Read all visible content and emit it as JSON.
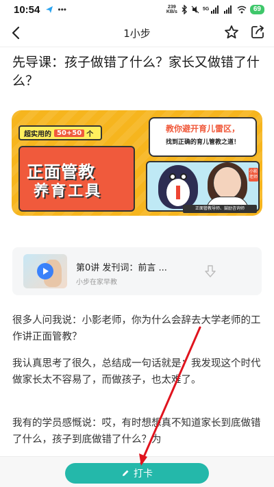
{
  "status_bar": {
    "time": "10:54",
    "net_speed_value": "239",
    "net_speed_unit": "KB/s",
    "battery": "69"
  },
  "nav": {
    "title": "1小步"
  },
  "article": {
    "title": "先导课：孩子做错了什么？家长又做错了什么？"
  },
  "banner": {
    "tag_prefix": "超实用的",
    "tag_highlight": "50+50",
    "tag_suffix": "个",
    "main_line1": "正面管教",
    "main_line2": "养育工具",
    "speech_line1": "教你避开育儿雷区，",
    "speech_line2": "找到正确的育儿管教之道！",
    "caption": "正面管教导师、鼓励咨询师",
    "side_name": "小影老师"
  },
  "audio_card": {
    "title": "第0讲 发刊词：前言 ...",
    "subtitle": "小步在家早教"
  },
  "body": {
    "p1": "很多人问我说：小影老师，你为什么会辞去大学老师的工作讲正面管教？",
    "p2": "我认真思考了很久，总结成一句话就是：我发现这个时代做家长太不容易了，而做孩子，也太难了。",
    "p3": "我有的学员感慨说：哎，有时想想真不知道家长到底做错了什么，孩子到底做错了什么？为"
  },
  "bottom": {
    "checkin_label": "打卡"
  },
  "colors": {
    "accent": "#24b8aa",
    "banner_bg": "#f6b51e",
    "banner_red": "#f05a3c",
    "annotation_red": "#e0141e"
  }
}
